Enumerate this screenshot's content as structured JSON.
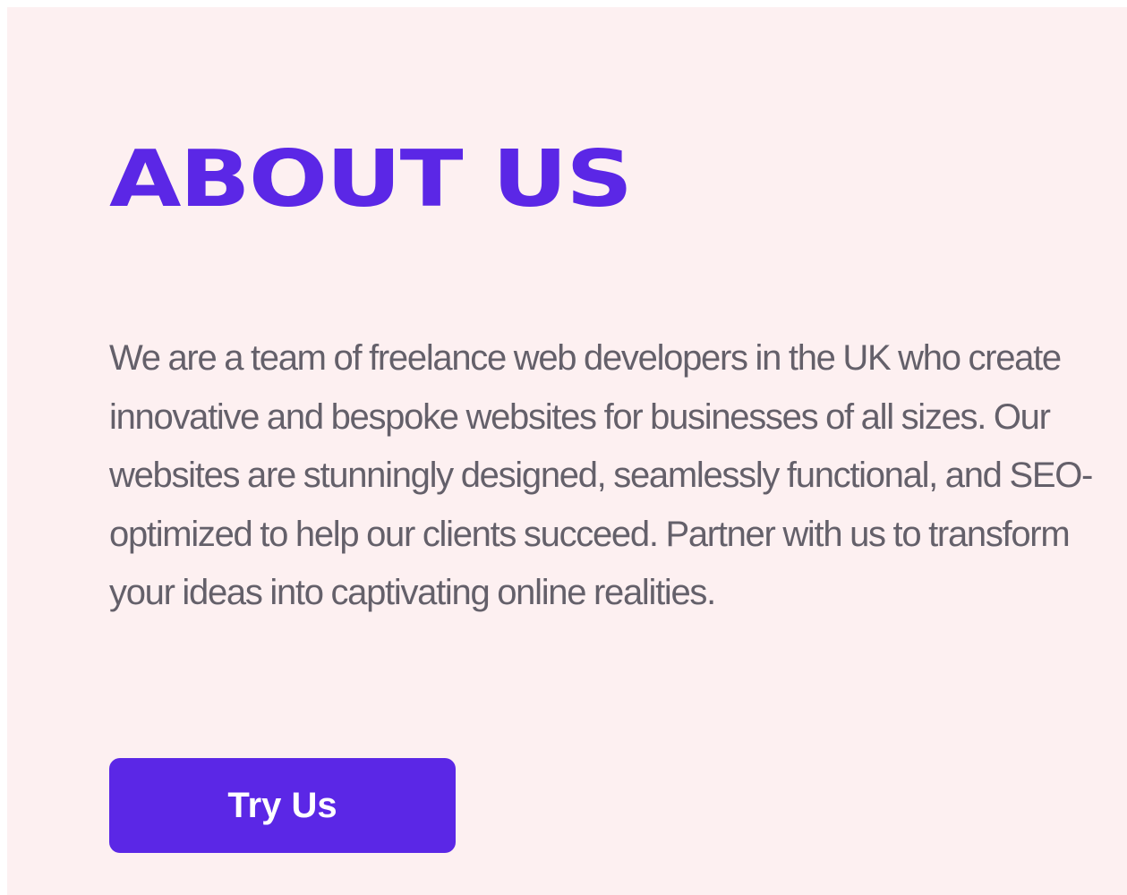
{
  "theme": {
    "background": "#fdf0f1",
    "accent": "#5b27e6",
    "body_text": "#64606a",
    "button_text": "#ffffff"
  },
  "about": {
    "title": "ABOUT US",
    "description": "We are a team of freelance web developers in the UK who create innovative and bespoke websites for businesses of all sizes. Our websites are stunningly designed, seamlessly functional, and SEO-optimized to help our clients succeed. Partner with us to transform your ideas into captivating online realities.",
    "cta_label": "Try Us"
  }
}
